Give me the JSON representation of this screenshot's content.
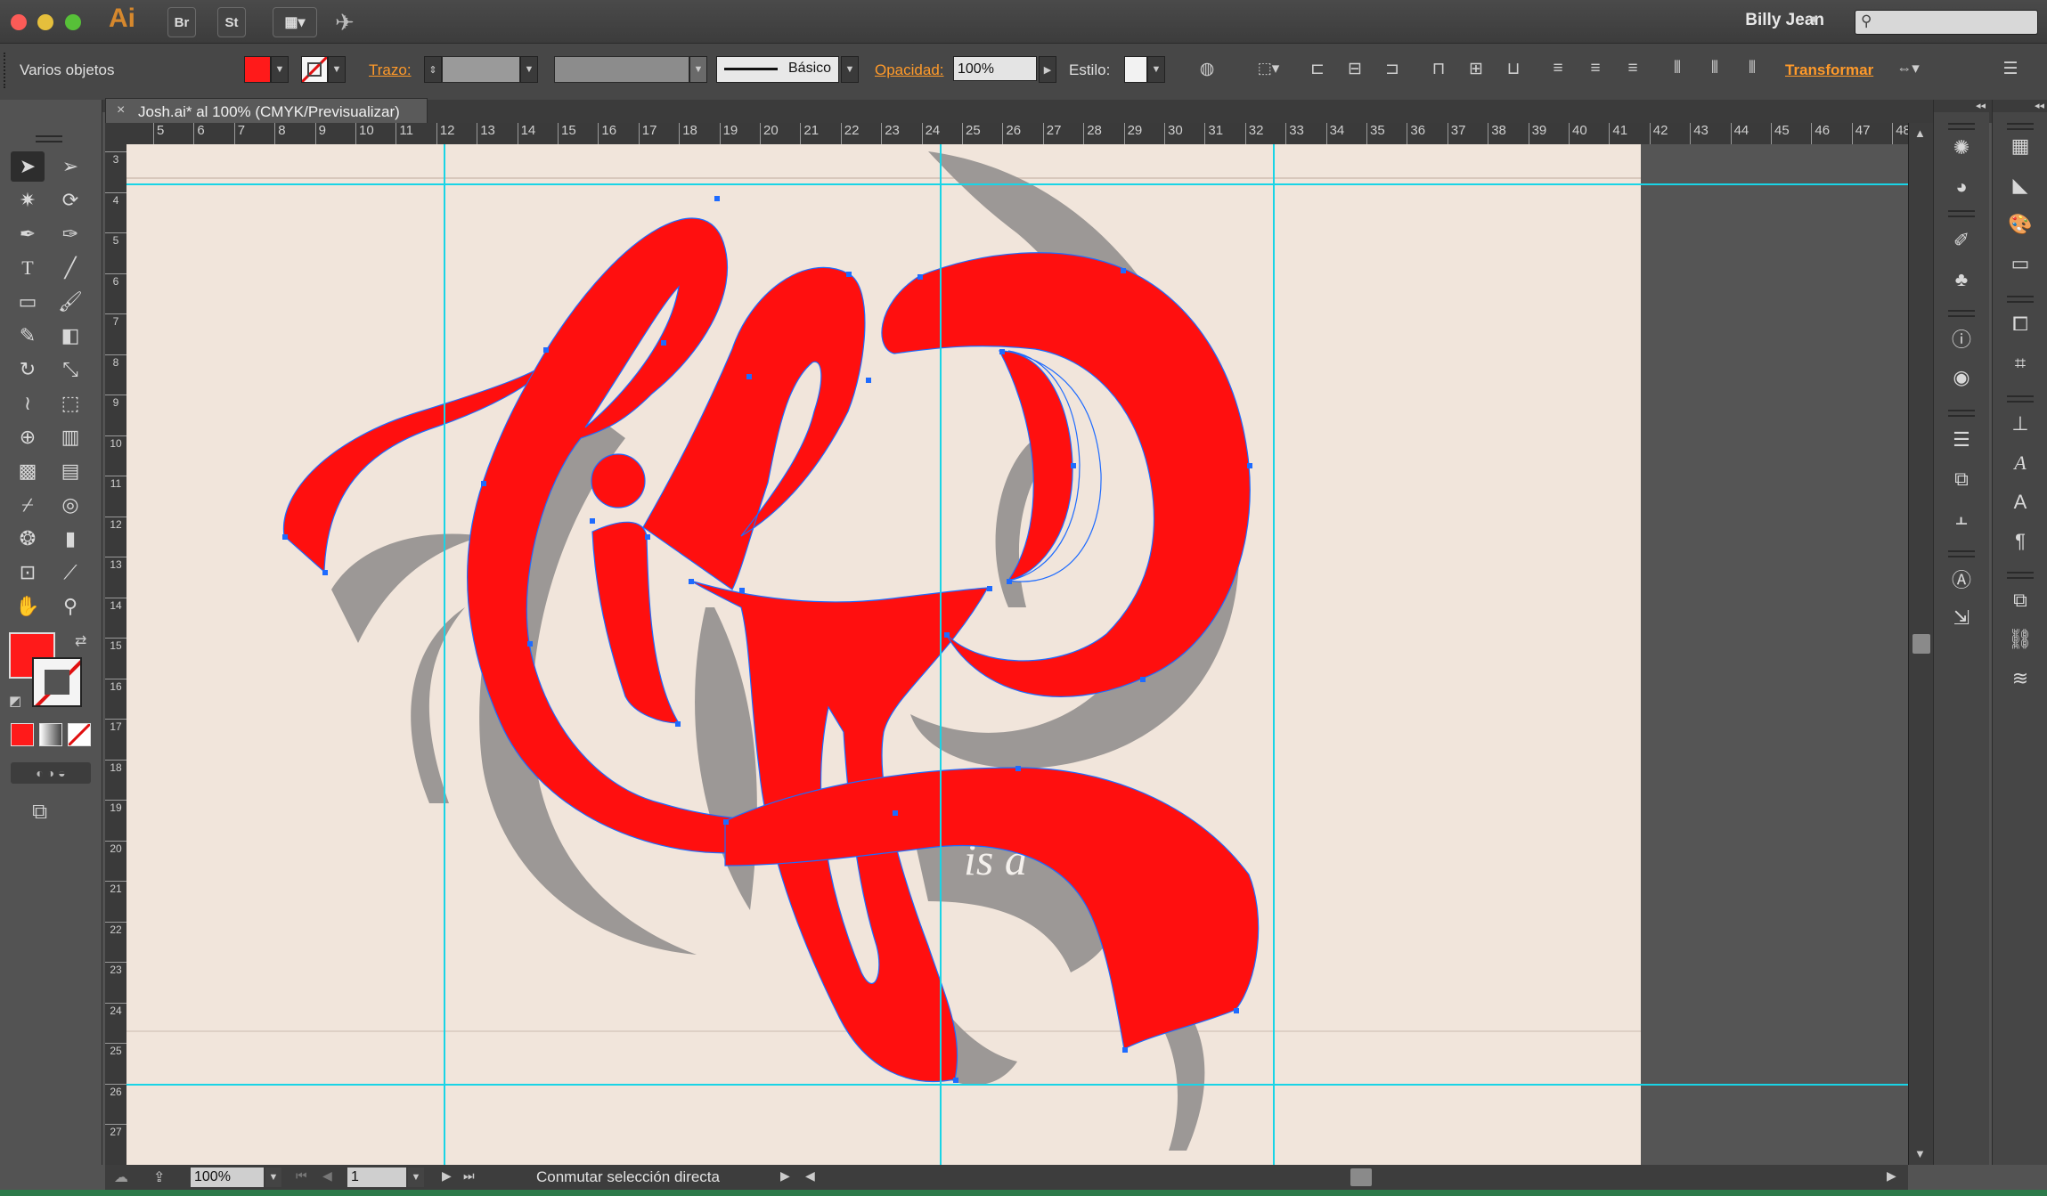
{
  "app": {
    "logo": "Ai",
    "bridge": "Br",
    "stock": "St",
    "user": "Billy Jean"
  },
  "control": {
    "selection_label": "Varios objetos",
    "stroke_label": "Trazo:",
    "brush_label": "Básico",
    "opacity_label": "Opacidad:",
    "opacity_value": "100%",
    "style_label": "Estilo:",
    "transform_label": "Transformar"
  },
  "document": {
    "tab_title": "Josh.ai* al 100% (CMYK/Previsualizar)"
  },
  "ruler": {
    "top_ticks": [
      "5",
      "6",
      "7",
      "8",
      "9",
      "10",
      "11",
      "12",
      "13",
      "14",
      "15",
      "16",
      "17",
      "18",
      "19",
      "20",
      "21",
      "22",
      "23",
      "24",
      "25",
      "26",
      "27",
      "28",
      "29",
      "30",
      "31",
      "32",
      "33",
      "34",
      "35",
      "36",
      "37",
      "38",
      "39",
      "40",
      "41",
      "42",
      "43",
      "44",
      "45",
      "46",
      "47",
      "48"
    ],
    "left_ticks": [
      "3",
      "4",
      "5",
      "6",
      "7",
      "8",
      "9",
      "10",
      "11",
      "12",
      "13",
      "14",
      "15",
      "16",
      "17",
      "18",
      "19",
      "20",
      "21",
      "22",
      "23",
      "24",
      "25",
      "26",
      "27"
    ]
  },
  "artwork": {
    "lettering": "Life",
    "shadow_text": "is a"
  },
  "status": {
    "zoom": "100%",
    "page": "1",
    "message": "Conmutar selección directa"
  },
  "colors": {
    "fill": "#ff0f0f",
    "guide": "#19d4e6",
    "accent": "#ff9a2a",
    "shadow": "#9c9896"
  }
}
